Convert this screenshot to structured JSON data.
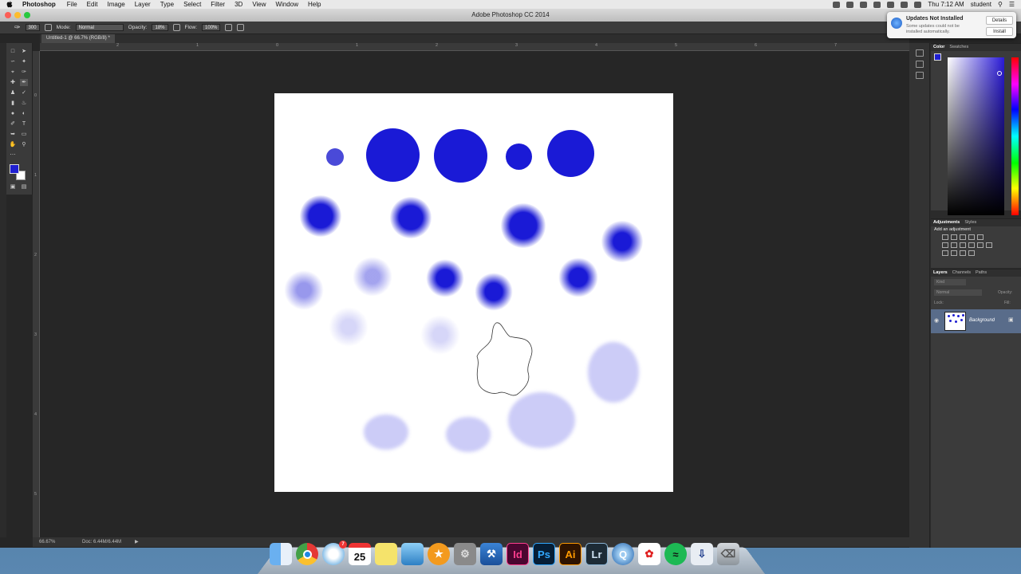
{
  "menubar": {
    "app_name": "Photoshop",
    "items": [
      "File",
      "Edit",
      "Image",
      "Layer",
      "Type",
      "Select",
      "Filter",
      "3D",
      "View",
      "Window",
      "Help"
    ],
    "clock": "Thu 7:12 AM",
    "user": "student"
  },
  "window": {
    "title": "Adobe Photoshop CC 2014"
  },
  "options": {
    "brush_size": "300",
    "mode_label": "Mode:",
    "mode_value": "Normal",
    "opacity_label": "Opacity:",
    "opacity_value": "18%",
    "flow_label": "Flow:",
    "flow_value": "100%"
  },
  "document": {
    "tab_title": "Untitled-1 @ 66.7% (RGB/8) *"
  },
  "ruler": {
    "h_marks": [
      "2",
      "1",
      "0",
      "1",
      "2",
      "3",
      "4",
      "5",
      "6",
      "7"
    ],
    "v_marks": [
      "0",
      "1",
      "2",
      "3",
      "4",
      "5"
    ]
  },
  "status": {
    "zoom": "66.67%",
    "doc": "Doc: 6.44M/6.44M"
  },
  "panels": {
    "color_tabs": [
      "Color",
      "Swatches"
    ],
    "adjust_tabs": [
      "Adjustments",
      "Styles"
    ],
    "adjust_hint": "Add an adjustment",
    "layers_tabs": [
      "Layers",
      "Channels",
      "Paths"
    ],
    "layer_kind": "Kind",
    "blend_mode": "Normal",
    "opacity_label": "Opacity:",
    "lock_label": "Lock:",
    "fill_label": "Fill:",
    "layer_name": "Background"
  },
  "notification": {
    "title": "Updates Not Installed",
    "body": "Some updates could not be installed automatically.",
    "details_label": "Details",
    "install_label": "Install"
  },
  "colors": {
    "foreground": "#1f1fd1",
    "background": "#ffffff",
    "brush_blue": "#1a1ad6"
  },
  "dock": {
    "apps": [
      {
        "name": "finder-icon",
        "label": ""
      },
      {
        "name": "chrome-icon",
        "label": ""
      },
      {
        "name": "safari-icon",
        "label": ""
      },
      {
        "name": "calendar-icon",
        "label": "25"
      },
      {
        "name": "stickies-icon",
        "label": ""
      },
      {
        "name": "preview-icon",
        "label": ""
      },
      {
        "name": "ibooks-icon",
        "label": ""
      },
      {
        "name": "system-prefs-icon",
        "label": ""
      },
      {
        "name": "xcode-icon",
        "label": ""
      },
      {
        "name": "indesign-icon",
        "label": "Id"
      },
      {
        "name": "photoshop-icon",
        "label": "Ps"
      },
      {
        "name": "illustrator-icon",
        "label": "Ai"
      },
      {
        "name": "lightroom-icon",
        "label": "Lr"
      },
      {
        "name": "quicktime-icon",
        "label": ""
      },
      {
        "name": "acrobat-icon",
        "label": ""
      },
      {
        "name": "spotify-icon",
        "label": ""
      },
      {
        "name": "downloads-icon",
        "label": ""
      },
      {
        "name": "trash-icon",
        "label": ""
      }
    ],
    "calendar_badge": "7"
  }
}
